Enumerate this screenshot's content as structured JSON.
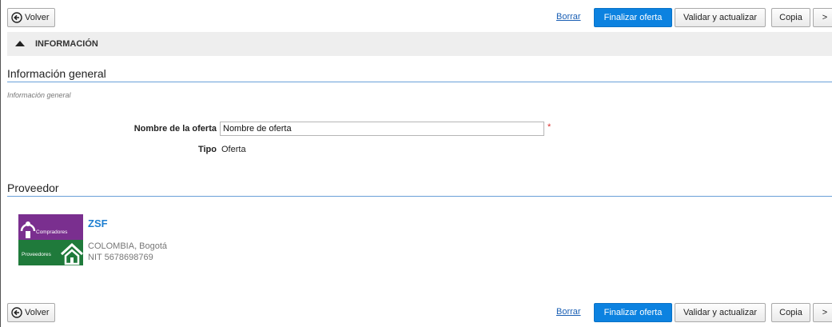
{
  "toolbar": {
    "back_label": "Volver",
    "delete_link": "Borrar",
    "finalize_label": "Finalizar oferta",
    "validate_label": "Validar y actualizar",
    "copy_label": "Copia",
    "next_label": ">"
  },
  "section": {
    "title": "INFORMACIÓN"
  },
  "general_info": {
    "heading": "Información general",
    "subtitle": "Información general",
    "fields": {
      "nombre_label": "Nombre de la oferta",
      "nombre_value": "Nombre de oferta",
      "required_marker": "*",
      "tipo_label": "Tipo",
      "tipo_value": "Oferta"
    }
  },
  "supplier": {
    "heading": "Proveedor",
    "name": "ZSF",
    "location": "COLOMBIA, Bogotá",
    "nit": "NIT 5678698769",
    "logo": {
      "top_text": "Compradores",
      "bottom_text": "Proveedores",
      "top_color": "#7a2f8f",
      "bottom_color": "#1f7a3b"
    }
  },
  "colors": {
    "primary": "#0c82e0",
    "link": "#1a5fb4",
    "heading_rule": "#6aa0d8",
    "required": "#d9302e"
  }
}
